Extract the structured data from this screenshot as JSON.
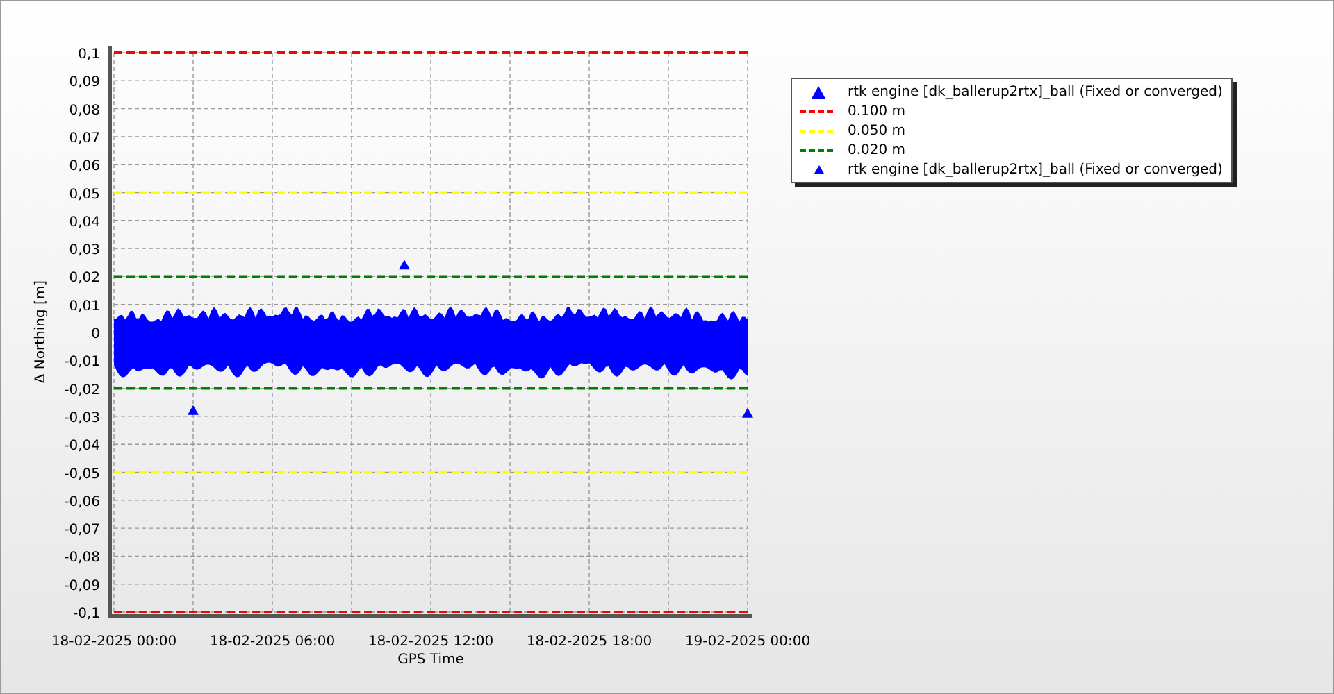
{
  "chart": {
    "chart_data": {
      "type": "scatter",
      "grid": true,
      "xlabel": "GPS Time",
      "ylabel": "Δ Northing [m]",
      "ylim": [
        -0.1,
        0.1
      ],
      "categories": [
        "18-02-2025 00:00",
        null,
        null,
        null,
        null,
        null,
        "18-02-2025 06:00",
        null,
        null,
        null,
        null,
        null,
        "18-02-2025 12:00",
        null,
        null,
        null,
        null,
        null,
        "18-02-2025 18:00",
        null,
        null,
        null,
        null,
        null,
        "19-02-2025 00:00"
      ],
      "yticks": [
        {
          "value": 0.1,
          "label": "0,1"
        },
        {
          "value": 0.09,
          "label": "0,09"
        },
        {
          "value": 0.08,
          "label": "0,08"
        },
        {
          "value": 0.07,
          "label": "0,07"
        },
        {
          "value": 0.06,
          "label": "0,06"
        },
        {
          "value": 0.05,
          "label": "0,05"
        },
        {
          "value": 0.04,
          "label": "0,04"
        },
        {
          "value": 0.03,
          "label": "0,03"
        },
        {
          "value": 0.02,
          "label": "0,02"
        },
        {
          "value": 0.01,
          "label": "0,01"
        },
        {
          "value": 0,
          "label": "0"
        },
        {
          "value": -0.01,
          "label": "-0,01"
        },
        {
          "value": -0.02,
          "label": "-0,02"
        },
        {
          "value": -0.03,
          "label": "-0,03"
        },
        {
          "value": -0.04,
          "label": "-0,04"
        },
        {
          "value": -0.05,
          "label": "-0,05"
        },
        {
          "value": -0.06,
          "label": "-0,06"
        },
        {
          "value": -0.07,
          "label": "-0,07"
        },
        {
          "value": -0.08,
          "label": "-0,08"
        },
        {
          "value": -0.09,
          "label": "-0,09"
        },
        {
          "value": -0.1,
          "label": "-0,1"
        }
      ],
      "series": [
        {
          "name": "rtk engine [dk_ballerup2rtx]_ball (Fixed or converged)",
          "type": "scatter",
          "color": "#0000ff",
          "values": [
            null,
            null,
            null,
            -0.028,
            null,
            null,
            null,
            null,
            null,
            null,
            null,
            0.024,
            null,
            null,
            null,
            null,
            null,
            null,
            null,
            null,
            null,
            null,
            null,
            null,
            -0.029
          ]
        },
        {
          "name": "0.100 m",
          "type": "line",
          "line_style": "dashed",
          "color": "#ff0000",
          "values": [
            0.1,
            0.1,
            0.1,
            0.1,
            0.1,
            0.1,
            0.1,
            0.1,
            0.1,
            0.1,
            0.1,
            0.1,
            0.1,
            0.1,
            0.1,
            0.1,
            0.1,
            0.1,
            0.1,
            0.1,
            0.1,
            0.1,
            0.1,
            0.1,
            0.1
          ]
        },
        {
          "type": "line",
          "line_style": "dashed",
          "color": "#ff0000",
          "values": [
            -0.1,
            -0.1,
            -0.1,
            -0.1,
            -0.1,
            -0.1,
            -0.1,
            -0.1,
            -0.1,
            -0.1,
            -0.1,
            -0.1,
            -0.1,
            -0.1,
            -0.1,
            -0.1,
            -0.1,
            -0.1,
            -0.1,
            -0.1,
            -0.1,
            -0.1,
            -0.1,
            -0.1,
            -0.1
          ]
        },
        {
          "name": "0.050 m",
          "type": "line",
          "line_style": "dashed",
          "color": "#ffff00",
          "values": [
            0.05,
            0.05,
            0.05,
            0.05,
            0.05,
            0.05,
            0.05,
            0.05,
            0.05,
            0.05,
            0.05,
            0.05,
            0.05,
            0.05,
            0.05,
            0.05,
            0.05,
            0.05,
            0.05,
            0.05,
            0.05,
            0.05,
            0.05,
            0.05,
            0.05
          ]
        },
        {
          "type": "line",
          "line_style": "dashed",
          "color": "#ffff00",
          "values": [
            -0.05,
            -0.05,
            -0.05,
            -0.05,
            -0.05,
            -0.05,
            -0.05,
            -0.05,
            -0.05,
            -0.05,
            -0.05,
            -0.05,
            -0.05,
            -0.05,
            -0.05,
            -0.05,
            -0.05,
            -0.05,
            -0.05,
            -0.05,
            -0.05,
            -0.05,
            -0.05,
            -0.05,
            -0.05
          ]
        },
        {
          "name": "0.020 m",
          "type": "line",
          "line_style": "dashed",
          "color": "#008000",
          "values": [
            0.02,
            0.02,
            0.02,
            0.02,
            0.02,
            0.02,
            0.02,
            0.02,
            0.02,
            0.02,
            0.02,
            0.02,
            0.02,
            0.02,
            0.02,
            0.02,
            0.02,
            0.02,
            0.02,
            0.02,
            0.02,
            0.02,
            0.02,
            0.02,
            0.02
          ]
        },
        {
          "type": "line",
          "line_style": "dashed",
          "color": "#008000",
          "values": [
            -0.02,
            -0.02,
            -0.02,
            -0.02,
            -0.02,
            -0.02,
            -0.02,
            -0.02,
            -0.02,
            -0.02,
            -0.02,
            -0.02,
            -0.02,
            -0.02,
            -0.02,
            -0.02,
            -0.02,
            -0.02,
            -0.02,
            -0.02,
            -0.02,
            -0.02,
            -0.02,
            -0.02,
            -0.02
          ]
        },
        {
          "name": "rtk engine [dk_ballerup2rtx]_ball (Fixed or converged)",
          "type": "scatter",
          "color": "#0000ff",
          "values": [
            null,
            null,
            null,
            null,
            null,
            null,
            null,
            null,
            null,
            null,
            null,
            null,
            null,
            null,
            null,
            null,
            null,
            null,
            null,
            null,
            null,
            null,
            null,
            null,
            null
          ]
        }
      ]
    }
  }
}
